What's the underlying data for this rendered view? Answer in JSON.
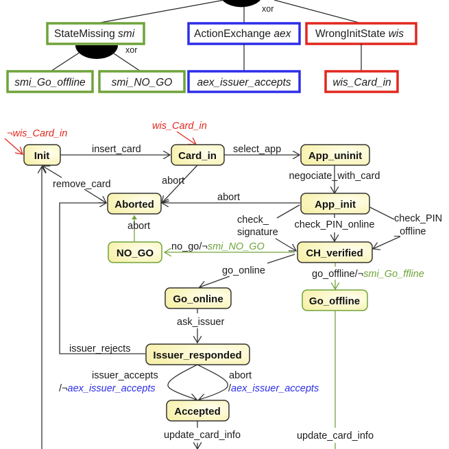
{
  "colors": {
    "green": "#6fa33a",
    "blue": "#2d2de8",
    "red": "#e0281e",
    "state_fill": "#fbf6bd",
    "edge": "#333333"
  },
  "feature_model": {
    "group_label_top": "xor",
    "group_label_smi": "xor",
    "features": [
      {
        "id": "smi",
        "name": "StateMissing",
        "abbr": "smi",
        "color": "green"
      },
      {
        "id": "aex",
        "name": "ActionExchange",
        "abbr": "aex",
        "color": "blue"
      },
      {
        "id": "wis",
        "name": "WrongInitState",
        "abbr": "wis",
        "color": "red"
      }
    ],
    "children": [
      {
        "id": "smi_go",
        "label": "smi_Go_offline",
        "color": "green"
      },
      {
        "id": "smi_nogo",
        "label": "smi_NO_GO",
        "color": "green"
      },
      {
        "id": "aex_ia",
        "label": "aex_issuer_accepts",
        "color": "blue"
      },
      {
        "id": "wis_ci",
        "label": "wis_Card_in",
        "color": "red"
      }
    ]
  },
  "state_machine": {
    "states": {
      "init": "Init",
      "card_in": "Card_in",
      "app_uninit": "App_uninit",
      "aborted": "Aborted",
      "app_init": "App_init",
      "no_go": "NO_GO",
      "ch_verified": "CH_verified",
      "go_online": "Go_online",
      "go_offline": "Go_offline",
      "issuer_responded": "Issuer_responded",
      "accepted": "Accepted"
    },
    "initial_markers": {
      "init": {
        "prefix": "¬",
        "condition": "wis_Card_in"
      },
      "card_in": {
        "condition": "wis_Card_in"
      }
    },
    "transitions": {
      "insert_card": "insert_card",
      "select_app": "select_app",
      "remove_card": "remove_card",
      "abort_card_in": "abort",
      "abort_app_init": "abort",
      "negociate": "negociate_with_card",
      "abort_no_go": "abort",
      "check_signature_1": "check_",
      "check_signature_2": "signature",
      "check_pin_online": "check_PIN_online",
      "check_pin_offline_1": "check_PIN",
      "check_pin_offline_2": "_offline",
      "no_go_event": "no_go/¬",
      "no_go_action": "smi_NO_GO",
      "go_online": "go_online",
      "go_offline_event": "go_offline/¬",
      "go_offline_action": "smi_Go_ffline",
      "ask_issuer": "ask_issuer",
      "issuer_rejects": "issuer_rejects",
      "issuer_accepts": "issuer_accepts",
      "issuer_accepts_prefix": "/¬",
      "issuer_accepts_action": "aex_issuer_accepts",
      "abort_issuer": "abort",
      "abort_issuer_prefix": "/",
      "abort_issuer_action": "aex_issuer_accepts",
      "update_card_info_1": "update_card_info",
      "update_card_info_2": "update_card_info"
    }
  }
}
